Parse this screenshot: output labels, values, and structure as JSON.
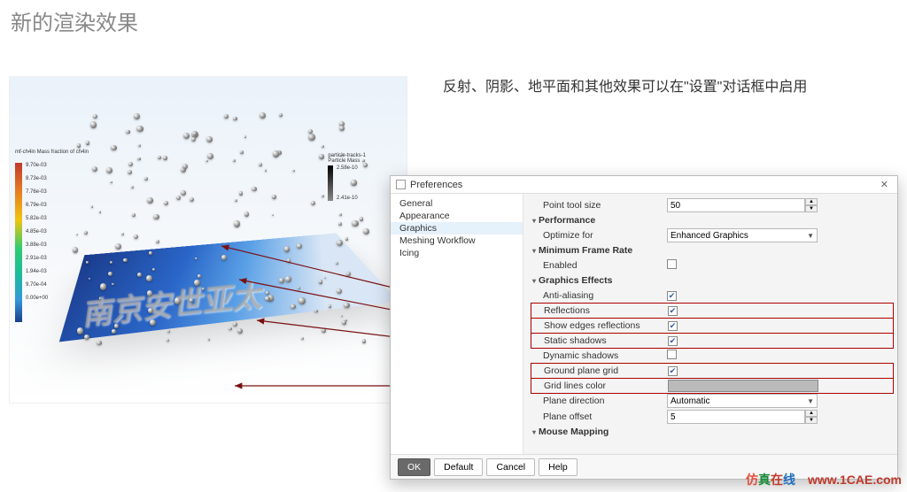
{
  "page_title": "新的渲染效果",
  "description": "反射、阴影、地平面和其他效果可以在\"设置\"对话框中启用",
  "viz": {
    "legend_title": "mf-ch4in\nMass fraction of ch4in",
    "legend_ticks": [
      "9.70e-03",
      "8.73e-03",
      "7.76e-03",
      "6.79e-03",
      "5.82e-03",
      "4.85e-03",
      "3.88e-03",
      "2.91e-03",
      "1.94e-03",
      "9.70e-04",
      "0.00e+00"
    ],
    "right_legend_title": "particle-tracks-1\nParticle Mass",
    "right_legend_ticks": [
      "2.58e-10",
      "2.41e-10"
    ],
    "watermark": "南京安世亚太"
  },
  "dialog": {
    "title": "Preferences",
    "nav": [
      "General",
      "Appearance",
      "Graphics",
      "Meshing Workflow",
      "Icing"
    ],
    "nav_selected_index": 2,
    "point_tool_size": {
      "label": "Point tool size",
      "value": "50"
    },
    "sections": {
      "performance": "Performance",
      "min_frame_rate": "Minimum Frame Rate",
      "graphics_effects": "Graphics Effects",
      "mouse_mapping": "Mouse Mapping"
    },
    "optimize_for": {
      "label": "Optimize for",
      "value": "Enhanced Graphics"
    },
    "enabled": {
      "label": "Enabled",
      "checked": false
    },
    "anti_aliasing": {
      "label": "Anti-aliasing",
      "checked": true
    },
    "reflections": {
      "label": "Reflections",
      "checked": true
    },
    "show_edges_reflections": {
      "label": "Show edges reflections",
      "checked": true
    },
    "static_shadows": {
      "label": "Static shadows",
      "checked": true
    },
    "dynamic_shadows": {
      "label": "Dynamic shadows",
      "checked": false
    },
    "ground_plane_grid": {
      "label": "Ground plane grid",
      "checked": true
    },
    "grid_lines_color": {
      "label": "Grid lines color"
    },
    "plane_direction": {
      "label": "Plane direction",
      "value": "Automatic"
    },
    "plane_offset": {
      "label": "Plane offset",
      "value": "5"
    },
    "buttons": {
      "ok": "OK",
      "default": "Default",
      "cancel": "Cancel",
      "help": "Help"
    }
  },
  "footer": {
    "brand": "仿真在线",
    "url": "www.1CAE.com"
  }
}
